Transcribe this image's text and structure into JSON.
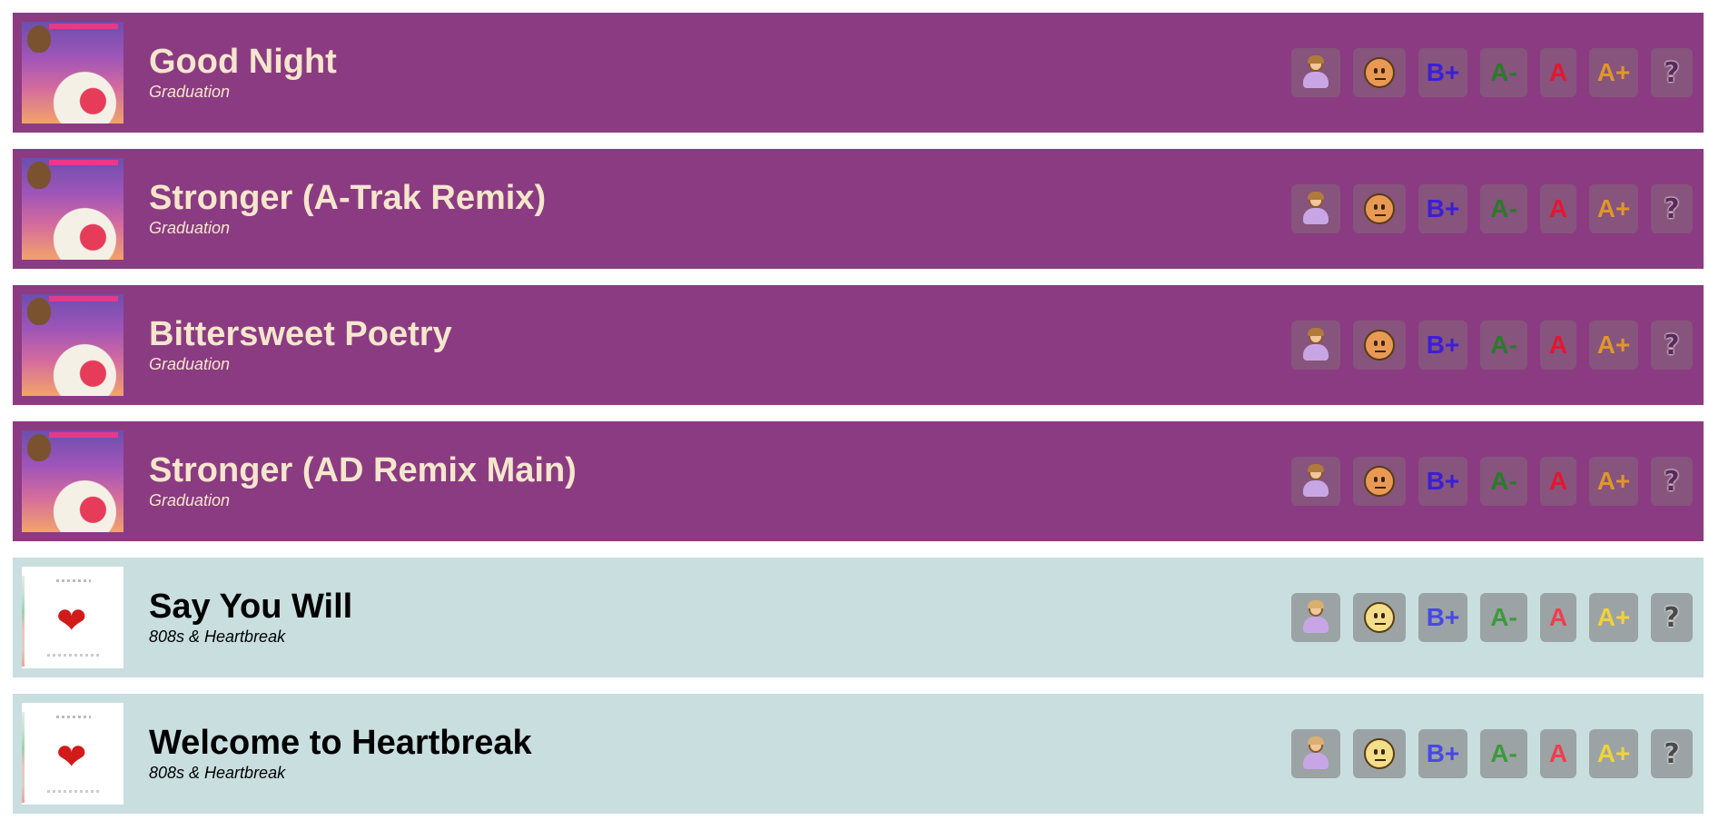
{
  "tracks": [
    {
      "title": "Good Night",
      "album": "Graduation",
      "style": "grad"
    },
    {
      "title": "Stronger (A-Trak Remix)",
      "album": "Graduation",
      "style": "grad"
    },
    {
      "title": "Bittersweet Poetry",
      "album": "Graduation",
      "style": "grad"
    },
    {
      "title": "Stronger (AD Remix Main)",
      "album": "Graduation",
      "style": "grad"
    },
    {
      "title": "Say You Will",
      "album": "808s & Heartbreak",
      "style": "h808"
    },
    {
      "title": "Welcome to Heartbreak",
      "album": "808s & Heartbreak",
      "style": "h808"
    }
  ],
  "rating_buttons": [
    {
      "id": "facepalm",
      "icon": "person-gesturing-no-icon",
      "label": ""
    },
    {
      "id": "meh",
      "icon": "neutral-face-icon",
      "label": ""
    },
    {
      "id": "bplus",
      "icon": "",
      "label": "B+"
    },
    {
      "id": "aminus",
      "icon": "",
      "label": "A-"
    },
    {
      "id": "a",
      "icon": "",
      "label": "A"
    },
    {
      "id": "aplus",
      "icon": "",
      "label": "A+"
    },
    {
      "id": "unknown",
      "icon": "question-mark-icon",
      "label": "?"
    }
  ],
  "colors": {
    "graduation_row": "#8b3b82",
    "heartbreak_row": "#c9dedf",
    "graduation_text": "#f5e6cc",
    "heartbreak_text": "#000000"
  }
}
